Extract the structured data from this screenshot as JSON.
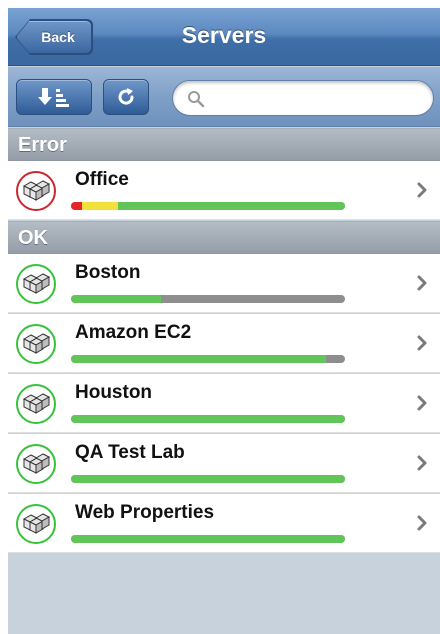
{
  "navbar": {
    "back_label": "Back",
    "title": "Servers"
  },
  "toolbar": {
    "sort_icon": "sort-descending-icon",
    "refresh_icon": "refresh-icon",
    "search_placeholder": "",
    "search_value": ""
  },
  "colors": {
    "ok": "#38c13b",
    "error": "#c8282f",
    "bar_green": "#62c55a",
    "bar_gray": "#8e8e8e",
    "bar_red": "#e4262b",
    "bar_yellow": "#f2e13a"
  },
  "sections": [
    {
      "title": "Error",
      "status": "error",
      "rows": [
        {
          "name": "Office",
          "health": {
            "red": 0.04,
            "yellow": 0.13,
            "green": 0.83,
            "gray": 0.0
          }
        }
      ]
    },
    {
      "title": "OK",
      "status": "ok",
      "rows": [
        {
          "name": "Boston",
          "health": {
            "red": 0,
            "yellow": 0,
            "green": 0.33,
            "gray": 0.67
          }
        },
        {
          "name": "Amazon EC2",
          "health": {
            "red": 0,
            "yellow": 0,
            "green": 0.93,
            "gray": 0.07
          }
        },
        {
          "name": "Houston",
          "health": {
            "red": 0,
            "yellow": 0,
            "green": 1.0,
            "gray": 0
          }
        },
        {
          "name": "QA Test Lab",
          "health": {
            "red": 0,
            "yellow": 0,
            "green": 1.0,
            "gray": 0
          }
        },
        {
          "name": "Web Properties",
          "health": {
            "red": 0,
            "yellow": 0,
            "green": 1.0,
            "gray": 0
          }
        }
      ]
    }
  ],
  "row_icons": {
    "server": "server-cluster-icon",
    "disclosure": "chevron-right-icon"
  }
}
